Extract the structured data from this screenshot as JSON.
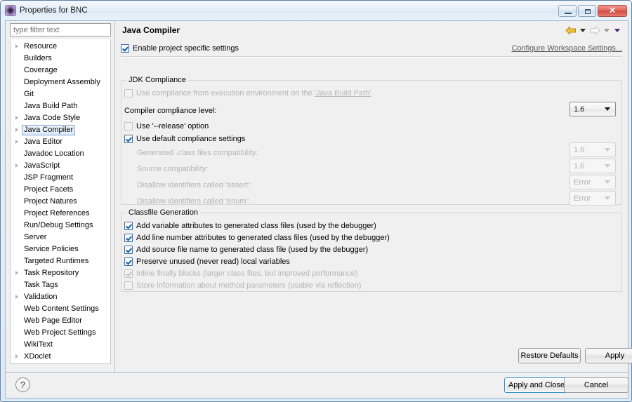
{
  "window": {
    "title": "Properties for BNC",
    "icon": "eclipse-properties-icon",
    "minimize_label": "",
    "maximize_label": "",
    "close_label": "✕"
  },
  "sidebar": {
    "filter_placeholder": "type filter text",
    "filter_value": "",
    "selected": "Java Compiler",
    "items": [
      {
        "label": "Resource",
        "expandable": true
      },
      {
        "label": "Builders",
        "expandable": false
      },
      {
        "label": "Coverage",
        "expandable": false
      },
      {
        "label": "Deployment Assembly",
        "expandable": false
      },
      {
        "label": "Git",
        "expandable": false
      },
      {
        "label": "Java Build Path",
        "expandable": false
      },
      {
        "label": "Java Code Style",
        "expandable": true
      },
      {
        "label": "Java Compiler",
        "expandable": true
      },
      {
        "label": "Java Editor",
        "expandable": true
      },
      {
        "label": "Javadoc Location",
        "expandable": false
      },
      {
        "label": "JavaScript",
        "expandable": true
      },
      {
        "label": "JSP Fragment",
        "expandable": false
      },
      {
        "label": "Project Facets",
        "expandable": false
      },
      {
        "label": "Project Natures",
        "expandable": false
      },
      {
        "label": "Project References",
        "expandable": false
      },
      {
        "label": "Run/Debug Settings",
        "expandable": false
      },
      {
        "label": "Server",
        "expandable": false
      },
      {
        "label": "Service Policies",
        "expandable": false
      },
      {
        "label": "Targeted Runtimes",
        "expandable": false
      },
      {
        "label": "Task Repository",
        "expandable": true
      },
      {
        "label": "Task Tags",
        "expandable": false
      },
      {
        "label": "Validation",
        "expandable": true
      },
      {
        "label": "Web Content Settings",
        "expandable": false
      },
      {
        "label": "Web Page Editor",
        "expandable": false
      },
      {
        "label": "Web Project Settings",
        "expandable": false
      },
      {
        "label": "WikiText",
        "expandable": false
      },
      {
        "label": "XDoclet",
        "expandable": true
      }
    ]
  },
  "page": {
    "title": "Java Compiler",
    "nav": {
      "back_icon": "arrow-left-icon",
      "back_menu_icon": "chevron-down-icon",
      "forward_icon": "arrow-right-icon",
      "forward_menu_icon": "chevron-down-icon",
      "overflow_menu_icon": "chevron-down-icon"
    },
    "enable_project_specific": {
      "label": "Enable project specific settings",
      "checked": true
    },
    "configure_workspace_link": "Configure Workspace Settings...",
    "jdk_compliance": {
      "title": "JDK Compliance",
      "use_execution_environment": {
        "label_prefix": "Use compliance from execution environment on the ",
        "link": "'Java Build Path'",
        "checked": false,
        "enabled": false
      },
      "compiler_compliance_level": {
        "label": "Compiler compliance level:",
        "value": "1.6",
        "enabled": true
      },
      "use_release_option": {
        "label": "Use '--release' option",
        "checked": false,
        "enabled": false
      },
      "use_default_compliance": {
        "label": "Use default compliance settings",
        "checked": true,
        "enabled": true
      },
      "generated_class_compat": {
        "label": "Generated .class files compatibility:",
        "value": "1.6",
        "enabled": false
      },
      "source_compat": {
        "label": "Source compatibility:",
        "value": "1.6",
        "enabled": false
      },
      "disallow_assert": {
        "label": "Disallow identifiers called 'assert':",
        "value": "Error",
        "enabled": false
      },
      "disallow_enum": {
        "label": "Disallow identifiers called 'enum':",
        "value": "Error",
        "enabled": false
      }
    },
    "classfile_generation": {
      "title": "Classfile Generation",
      "options": [
        {
          "label": "Add variable attributes to generated class files (used by the debugger)",
          "checked": true,
          "enabled": true
        },
        {
          "label": "Add line number attributes to generated class files (used by the debugger)",
          "checked": true,
          "enabled": true
        },
        {
          "label": "Add source file name to generated class file (used by the debugger)",
          "checked": true,
          "enabled": true
        },
        {
          "label": "Preserve unused (never read) local variables",
          "checked": true,
          "enabled": true
        },
        {
          "label": "Inline finally blocks (larger class files, but improved performance)",
          "checked": true,
          "enabled": false
        },
        {
          "label": "Store information about method parameters (usable via reflection)",
          "checked": false,
          "enabled": false
        }
      ]
    },
    "restore_defaults_label": "Restore Defaults",
    "apply_label": "Apply"
  },
  "footer": {
    "help_icon": "question-mark-icon",
    "help_glyph": "?",
    "apply_and_close_label": "Apply and Close",
    "cancel_label": "Cancel"
  },
  "colors": {
    "dialog_bg": "#f0f0f0",
    "title_bar": "#e4eef7",
    "frame_border": "#5a7fa6",
    "selection": "#dcecfb",
    "selection_border": "#7da2ce",
    "close_button": "#d04a40",
    "back_arrow": "#e3b01f",
    "forward_arrow": "#cfcfcf",
    "default_button_border": "#2d8fd0",
    "disabled_text": "#b4b4b4"
  }
}
